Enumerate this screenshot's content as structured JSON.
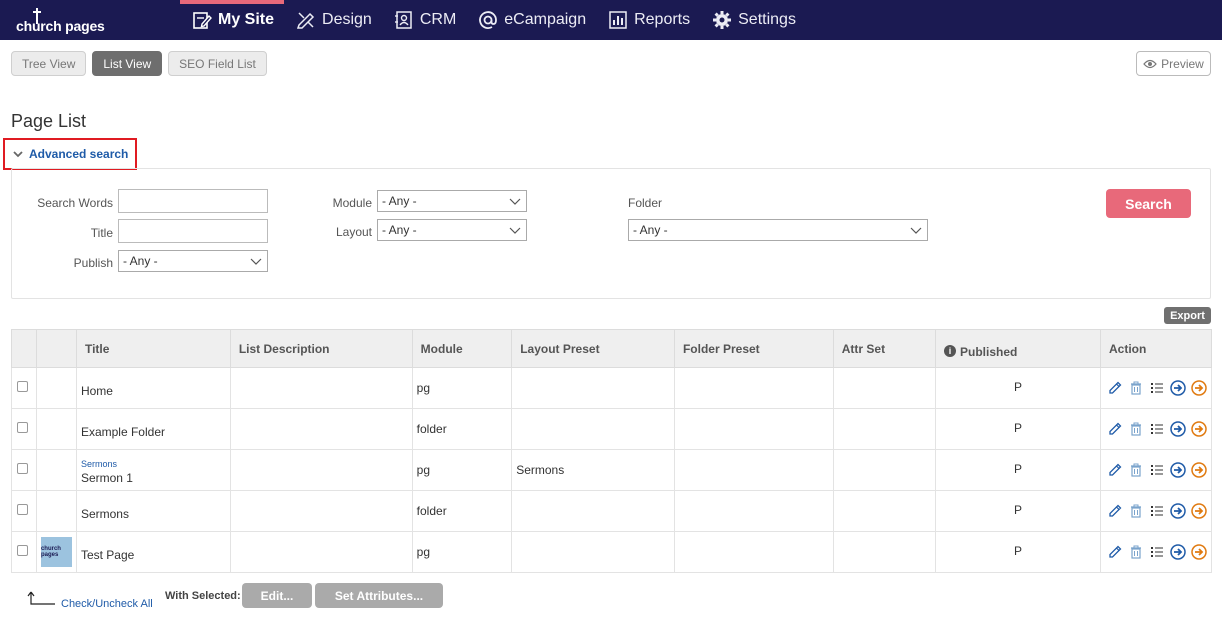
{
  "app": {
    "logo": "church pages"
  },
  "nav": [
    {
      "label": "My Site",
      "icon": "edit-page-icon",
      "active": true
    },
    {
      "label": "Design",
      "icon": "pencil-ruler-icon",
      "active": false
    },
    {
      "label": "CRM",
      "icon": "contact-card-icon",
      "active": false
    },
    {
      "label": "eCampaign",
      "icon": "at-icon",
      "active": false
    },
    {
      "label": "Reports",
      "icon": "bar-chart-icon",
      "active": false
    },
    {
      "label": "Settings",
      "icon": "gear-icon",
      "active": false
    }
  ],
  "views": {
    "tree": "Tree View",
    "list": "List View",
    "seo": "SEO Field List",
    "preview": "Preview"
  },
  "page_title": "Page List",
  "advanced": {
    "toggle_label": "Advanced search",
    "search_words_label": "Search Words",
    "search_words_value": "",
    "title_label": "Title",
    "title_value": "",
    "publish_label": "Publish",
    "publish_value": "- Any -",
    "module_label": "Module",
    "module_value": "- Any -",
    "layout_label": "Layout",
    "layout_value": "- Any -",
    "folder_label": "Folder",
    "folder_value": "- Any -",
    "search_button": "Search"
  },
  "export_button": "Export",
  "table": {
    "columns": {
      "title": "Title",
      "list_description": "List Description",
      "module": "Module",
      "layout_preset": "Layout Preset",
      "folder_preset": "Folder Preset",
      "attr_set": "Attr Set",
      "published": "Published",
      "action": "Action"
    },
    "rows": [
      {
        "parent": "",
        "title": "Home",
        "description": "",
        "module": "pg",
        "layout": "",
        "folder": "",
        "attr": "",
        "published": "P",
        "thumb": ""
      },
      {
        "parent": "",
        "title": "Example Folder",
        "description": "",
        "module": "folder",
        "layout": "",
        "folder": "",
        "attr": "",
        "published": "P",
        "thumb": ""
      },
      {
        "parent": "Sermons",
        "title": "Sermon 1",
        "description": "",
        "module": "pg",
        "layout": "Sermons",
        "folder": "",
        "attr": "",
        "published": "P",
        "thumb": ""
      },
      {
        "parent": "",
        "title": "Sermons",
        "description": "",
        "module": "folder",
        "layout": "",
        "folder": "",
        "attr": "",
        "published": "P",
        "thumb": ""
      },
      {
        "parent": "",
        "title": "Test Page",
        "description": "",
        "module": "pg",
        "layout": "",
        "folder": "",
        "attr": "",
        "published": "P",
        "thumb": "church pages"
      }
    ]
  },
  "bottom": {
    "check_all": "Check/Uncheck All",
    "with_selected": "With Selected:",
    "edit_button": "Edit...",
    "set_attributes_button": "Set Attributes..."
  },
  "colors": {
    "nav_bg": "#1b1a52",
    "accent": "#e8697a",
    "link": "#1f5ba8",
    "highlight_border": "#e01b22"
  }
}
